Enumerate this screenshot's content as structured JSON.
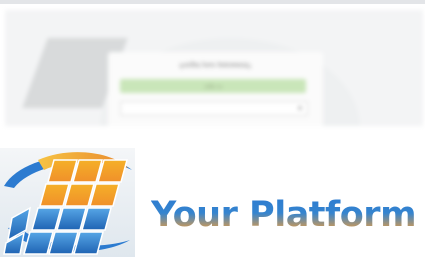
{
  "reflection": {
    "card_title": "Forgot your password?",
    "button_label": "Sign in"
  },
  "brand": {
    "name": "Your Platform",
    "logo_icon": "solar-panel-logo-icon"
  },
  "colors": {
    "brand_blue": "#2c7bd0",
    "brand_orange": "#e39a3c",
    "brand_yellow": "#f4b525"
  }
}
